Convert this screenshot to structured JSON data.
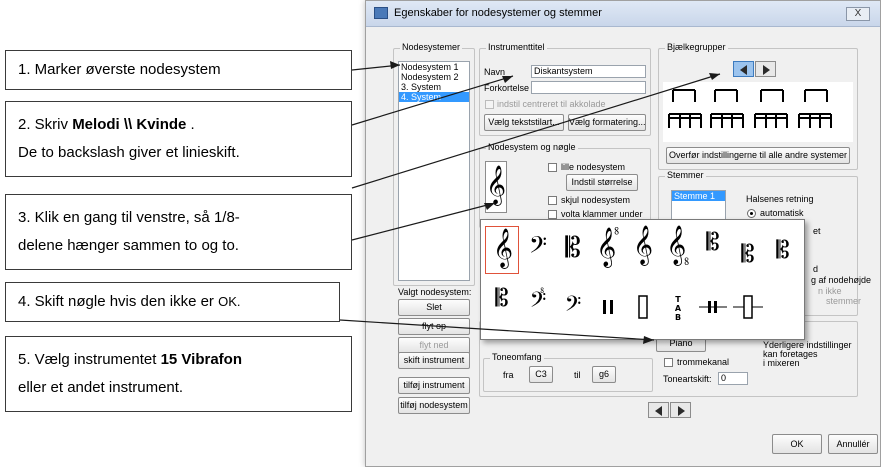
{
  "dialog": {
    "title": "Egenskaber for nodesystemer og stemmer",
    "close_label": "X"
  },
  "nodesystemer": {
    "label": "Nodesystemer",
    "items": [
      "Nodesystem 1",
      "Nodesystem 2",
      "3. System",
      "4. System"
    ],
    "selected_index": 3
  },
  "instrumenttitel": {
    "label": "Instrumenttitel",
    "navn_label": "Navn",
    "navn_value": "Diskantsystem",
    "forkortelse_label": "Forkortelse",
    "forkortelse_value": "",
    "centered_label": "indstil centreret til akkolade",
    "text_style_button": "Vælg tekststilart...",
    "format_button": "Vælg formatering..."
  },
  "node_og_noegle": {
    "label": "Nodesystem og nøgle",
    "small_staff": "lille nodesystem",
    "size_button": "Indstil størrelse",
    "hide_staff": "skjul nodesystem",
    "volta_under": "volta klammer under"
  },
  "valgt": {
    "label": "Valgt nodesystem:",
    "slet": "Slet",
    "flyt_op": "flyt op",
    "flyt_ned": "flyt ned",
    "skift_instrument": "skift instrument",
    "tilfoej_instrument": "tilføj instrument",
    "tilfoej_nodesystem": "tilføj nodesystem"
  },
  "bjaelke": {
    "label": "Bjælkegrupper",
    "transfer_button": "Overfør indstillingerne til alle andre systemer"
  },
  "stemmer": {
    "label": "Stemmer",
    "items": [
      "Stemme 1"
    ],
    "halse_label": "Halsenes retning",
    "radio_auto": "automatisk",
    "partial_1": "et",
    "partial_2": "d",
    "partial_3": "g af nodehøjde",
    "partial_4": "n ikke",
    "partial_5": "stemmer"
  },
  "instrument_area": {
    "piano_button": "Piano",
    "note_1": "Yderligere indstillinger",
    "note_2": "kan foretages",
    "note_3": "i mixeren"
  },
  "toneomfang": {
    "label": "Toneomfang",
    "fra_label": "fra",
    "fra_value": "C3",
    "til_label": "til",
    "til_value": "g6",
    "trommekanal": "trommekanal",
    "toneartskift_label": "Toneartskift:",
    "toneartskift_value": "0"
  },
  "footer": {
    "ok": "OK",
    "annuller": "Annullér"
  },
  "palette": {
    "row1": [
      "treble",
      "bass",
      "alto",
      "treble-8va",
      "treble-15ma",
      "treble-8vb",
      "soprano",
      "tenor",
      "baritone-c"
    ],
    "row2": [
      "c-clef-high",
      "bass-8va",
      "bass-alt",
      "percussion-1",
      "percussion-2",
      "tab",
      "percussion-3",
      "percussion-4"
    ]
  },
  "callouts": [
    {
      "text": "1. Marker øverste nodesystem"
    },
    {
      "pre": "2. Skriv ",
      "bold": "Melodi \\\\ Kvinde",
      "post": " .",
      "line2": "De to backslash giver et linieskift."
    },
    {
      "line1": "3. Klik en gang til venstre, så 1/8-",
      "line2": "delene hænger sammen to og to."
    },
    {
      "text": "4. Skift nøgle hvis den ikke er ",
      "small": "OK."
    },
    {
      "pre": "5. Vælg instrumentet ",
      "bold": "15 Vibrafon",
      "line2": "eller et andet instrument."
    }
  ]
}
